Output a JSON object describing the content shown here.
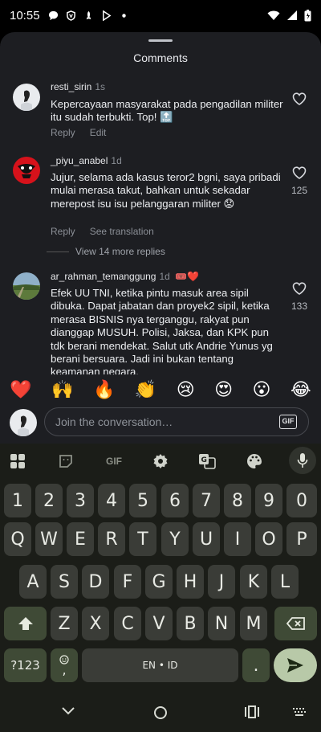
{
  "status_bar": {
    "time": "10:55"
  },
  "sheet": {
    "title": "Comments"
  },
  "comments": [
    {
      "username": "resti_sirin",
      "time": "1s",
      "text": "Kepercayaan masyarakat pada pengadilan militer itu sudah terbukti. Top! 🔝",
      "actions": [
        "Reply",
        "Edit"
      ],
      "likes": ""
    },
    {
      "username": "_piyu_anabel",
      "time": "1d",
      "text": "Jujur, selama ada kasus teror2 bgni, saya pribadi mulai merasa takut, bahkan untuk sekadar merepost isu isu pelanggaran militer 😟",
      "actions": [
        "Reply",
        "See translation"
      ],
      "likes": "125"
    },
    {
      "username": "ar_rahman_temanggung",
      "time": "1d",
      "badge": "🎟️❤️",
      "text": "Efek UU TNI, ketika pintu masuk area sipil dibuka. Dapat jabatan dan proyek2 sipil, ketika merasa BISNIS nya terganggu, rakyat pun dianggap MUSUH. Polisi, Jaksa, dan KPK pun tdk berani mendekat. Salut utk Andrie Yunus yg berani bersuara. Jadi ini bukan tentang keamanan negara.",
      "likes": "133"
    }
  ],
  "more_replies": "View 14 more replies",
  "emoji_bar": [
    "❤️",
    "🙌",
    "🔥",
    "👏",
    "😢",
    "😍",
    "😮",
    "😂"
  ],
  "composer": {
    "placeholder": "Join the conversation…",
    "gif_label": "GIF"
  },
  "keyboard": {
    "toolbar_gif": "GIF",
    "row_numbers": [
      "1",
      "2",
      "3",
      "4",
      "5",
      "6",
      "7",
      "8",
      "9",
      "0"
    ],
    "row_1": [
      "Q",
      "W",
      "E",
      "R",
      "T",
      "Y",
      "U",
      "I",
      "O",
      "P"
    ],
    "row_2": [
      "A",
      "S",
      "D",
      "F",
      "G",
      "H",
      "J",
      "K",
      "L"
    ],
    "row_3": [
      "Z",
      "X",
      "C",
      "V",
      "B",
      "N",
      "M"
    ],
    "symbols_label": "?123",
    "comma_label": ",",
    "space_label": "EN • ID",
    "period_label": "."
  },
  "colors": {
    "sheet_bg": "#1d1e22",
    "keyboard_bg": "#1b1d18",
    "key_bg": "#3a3c37",
    "accent_key": "#b8c9a8"
  }
}
